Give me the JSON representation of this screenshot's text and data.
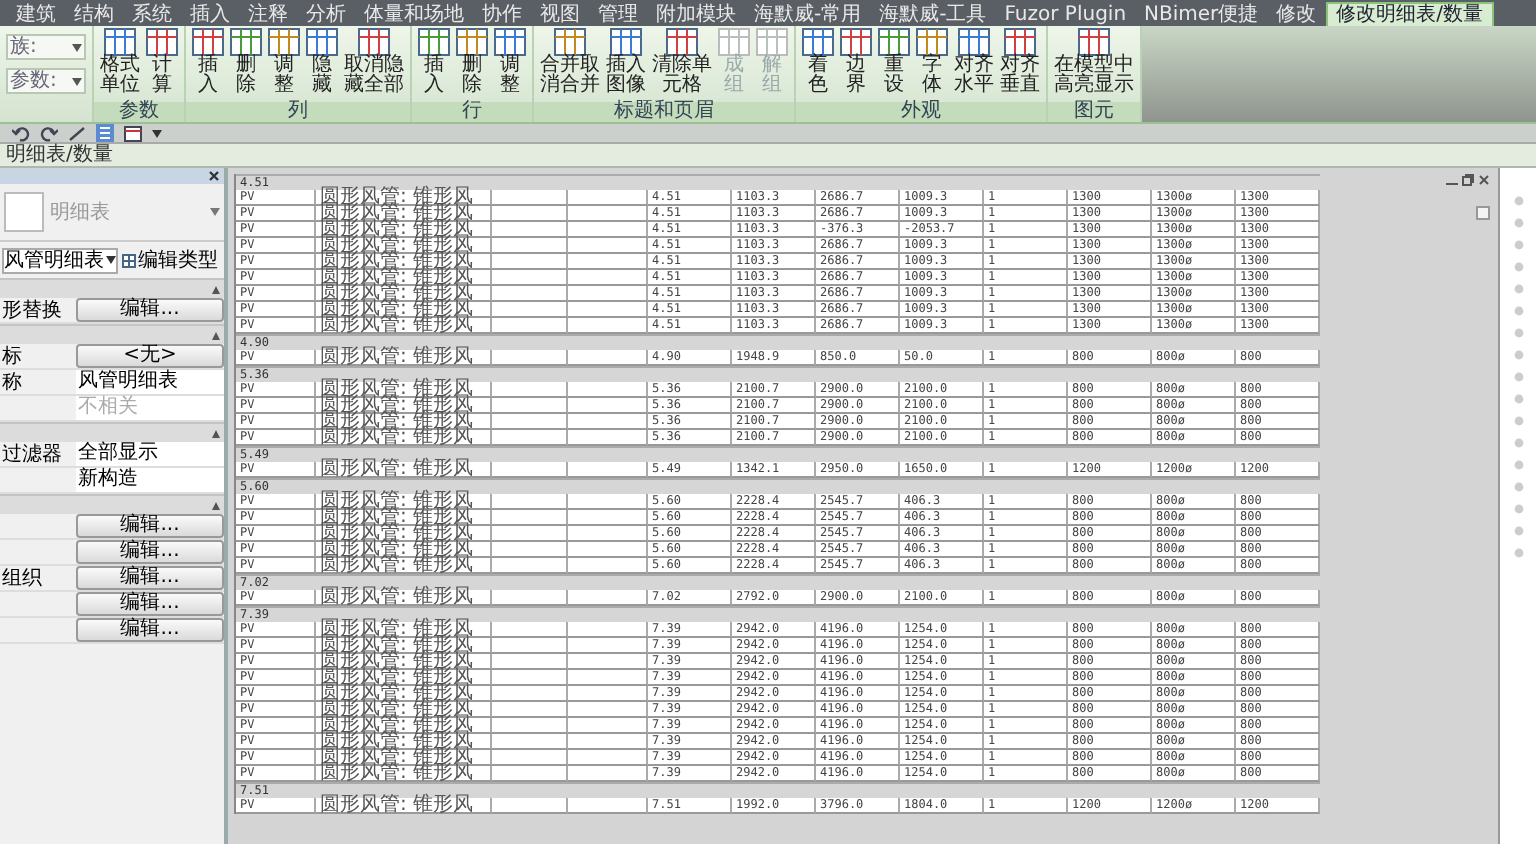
{
  "menu_tabs": [
    {
      "label": "建筑",
      "selected": false
    },
    {
      "label": "结构",
      "selected": false
    },
    {
      "label": "系统",
      "selected": false
    },
    {
      "label": "插入",
      "selected": false
    },
    {
      "label": "注释",
      "selected": false
    },
    {
      "label": "分析",
      "selected": false
    },
    {
      "label": "体量和场地",
      "selected": false
    },
    {
      "label": "协作",
      "selected": false
    },
    {
      "label": "视图",
      "selected": false
    },
    {
      "label": "管理",
      "selected": false
    },
    {
      "label": "附加模块",
      "selected": false
    },
    {
      "label": "海默威-常用",
      "selected": false
    },
    {
      "label": "海默威-工具",
      "selected": false
    },
    {
      "label": "Fuzor Plugin",
      "selected": false
    },
    {
      "label": "NBimer便捷",
      "selected": false
    },
    {
      "label": "修改",
      "selected": false
    },
    {
      "label": "修改明细表/数量",
      "selected": true
    }
  ],
  "ribbon_selectors": [
    {
      "label": "族:"
    },
    {
      "label": "参数:"
    }
  ],
  "ribbon_groups": [
    {
      "label": "参数",
      "buttons": [
        {
          "label": "格式单位",
          "disabled": false
        },
        {
          "label": "计算",
          "disabled": false
        }
      ]
    },
    {
      "label": "列",
      "buttons": [
        {
          "label": "插入",
          "disabled": false
        },
        {
          "label": "删除",
          "disabled": false
        },
        {
          "label": "调整",
          "disabled": false
        },
        {
          "label": "隐藏",
          "disabled": false
        },
        {
          "label": "取消隐藏全部",
          "disabled": false
        }
      ]
    },
    {
      "label": "行",
      "buttons": [
        {
          "label": "插入",
          "disabled": false
        },
        {
          "label": "删除",
          "disabled": false
        },
        {
          "label": "调整",
          "disabled": false
        }
      ]
    },
    {
      "label": "标题和页眉",
      "buttons": [
        {
          "label": "合并取消合并",
          "disabled": false
        },
        {
          "label": "插入图像",
          "disabled": false
        },
        {
          "label": "清除单元格",
          "disabled": false
        },
        {
          "label": "成组",
          "disabled": true
        },
        {
          "label": "解组",
          "disabled": true
        }
      ]
    },
    {
      "label": "外观",
      "buttons": [
        {
          "label": "着色",
          "disabled": false
        },
        {
          "label": "边界",
          "disabled": false
        },
        {
          "label": "重设",
          "disabled": false
        },
        {
          "label": "字体",
          "disabled": false
        },
        {
          "label": "对齐水平",
          "disabled": false
        },
        {
          "label": "对齐垂直",
          "disabled": false
        }
      ]
    },
    {
      "label": "图元",
      "buttons": [
        {
          "label": "在模型中高亮显示",
          "disabled": false
        }
      ]
    }
  ],
  "view_title": "明细表/数量",
  "properties": {
    "type_name": "明细表",
    "selector": "风管明细表",
    "edit_type": "编辑类型",
    "rows": [
      {
        "kind": "section"
      },
      {
        "kind": "button",
        "label": "形替换",
        "value": "编辑..."
      },
      {
        "kind": "section"
      },
      {
        "kind": "button",
        "label": "标",
        "value": "<无>"
      },
      {
        "kind": "text",
        "label": "称",
        "value": "风管明细表",
        "disabled": false
      },
      {
        "kind": "text",
        "value": "不相关",
        "disabled": true
      },
      {
        "kind": "section"
      },
      {
        "kind": "text",
        "label": "过滤器",
        "value": "全部显示",
        "disabled": false
      },
      {
        "kind": "text",
        "value": "新构造",
        "disabled": false
      },
      {
        "kind": "section"
      },
      {
        "kind": "button",
        "value": "编辑..."
      },
      {
        "kind": "button",
        "value": "编辑..."
      },
      {
        "kind": "button",
        "label": "组织",
        "value": "编辑..."
      },
      {
        "kind": "button",
        "value": "编辑..."
      },
      {
        "kind": "button",
        "value": "编辑..."
      }
    ]
  },
  "schedule": {
    "groups": [
      {
        "label": "4.51",
        "rows": [
          {
            "type": "PV",
            "family": "圆形风管: 锥形风",
            "values": [
              "4.51",
              "1103.3",
              "2686.7",
              "1009.3",
              "1",
              "1300",
              "1300ø",
              "1300"
            ]
          },
          {
            "type": "PV",
            "family": "圆形风管: 锥形风",
            "values": [
              "4.51",
              "1103.3",
              "2686.7",
              "1009.3",
              "1",
              "1300",
              "1300ø",
              "1300"
            ]
          },
          {
            "type": "PV",
            "family": "圆形风管: 锥形风",
            "values": [
              "4.51",
              "1103.3",
              "-376.3",
              "-2053.7",
              "1",
              "1300",
              "1300ø",
              "1300"
            ]
          },
          {
            "type": "PV",
            "family": "圆形风管: 锥形风",
            "values": [
              "4.51",
              "1103.3",
              "2686.7",
              "1009.3",
              "1",
              "1300",
              "1300ø",
              "1300"
            ]
          },
          {
            "type": "PV",
            "family": "圆形风管: 锥形风",
            "values": [
              "4.51",
              "1103.3",
              "2686.7",
              "1009.3",
              "1",
              "1300",
              "1300ø",
              "1300"
            ]
          },
          {
            "type": "PV",
            "family": "圆形风管: 锥形风",
            "values": [
              "4.51",
              "1103.3",
              "2686.7",
              "1009.3",
              "1",
              "1300",
              "1300ø",
              "1300"
            ]
          },
          {
            "type": "PV",
            "family": "圆形风管: 锥形风",
            "values": [
              "4.51",
              "1103.3",
              "2686.7",
              "1009.3",
              "1",
              "1300",
              "1300ø",
              "1300"
            ]
          },
          {
            "type": "PV",
            "family": "圆形风管: 锥形风",
            "values": [
              "4.51",
              "1103.3",
              "2686.7",
              "1009.3",
              "1",
              "1300",
              "1300ø",
              "1300"
            ]
          },
          {
            "type": "PV",
            "family": "圆形风管: 锥形风",
            "values": [
              "4.51",
              "1103.3",
              "2686.7",
              "1009.3",
              "1",
              "1300",
              "1300ø",
              "1300"
            ]
          }
        ]
      },
      {
        "label": "4.90",
        "rows": [
          {
            "type": "PV",
            "family": "圆形风管: 锥形风",
            "values": [
              "4.90",
              "1948.9",
              "850.0",
              "50.0",
              "1",
              "800",
              "800ø",
              "800"
            ]
          }
        ]
      },
      {
        "label": "5.36",
        "rows": [
          {
            "type": "PV",
            "family": "圆形风管: 锥形风",
            "values": [
              "5.36",
              "2100.7",
              "2900.0",
              "2100.0",
              "1",
              "800",
              "800ø",
              "800"
            ]
          },
          {
            "type": "PV",
            "family": "圆形风管: 锥形风",
            "values": [
              "5.36",
              "2100.7",
              "2900.0",
              "2100.0",
              "1",
              "800",
              "800ø",
              "800"
            ]
          },
          {
            "type": "PV",
            "family": "圆形风管: 锥形风",
            "values": [
              "5.36",
              "2100.7",
              "2900.0",
              "2100.0",
              "1",
              "800",
              "800ø",
              "800"
            ]
          },
          {
            "type": "PV",
            "family": "圆形风管: 锥形风",
            "values": [
              "5.36",
              "2100.7",
              "2900.0",
              "2100.0",
              "1",
              "800",
              "800ø",
              "800"
            ]
          }
        ]
      },
      {
        "label": "5.49",
        "rows": [
          {
            "type": "PV",
            "family": "圆形风管: 锥形风",
            "values": [
              "5.49",
              "1342.1",
              "2950.0",
              "1650.0",
              "1",
              "1200",
              "1200ø",
              "1200"
            ]
          }
        ]
      },
      {
        "label": "5.60",
        "rows": [
          {
            "type": "PV",
            "family": "圆形风管: 锥形风",
            "values": [
              "5.60",
              "2228.4",
              "2545.7",
              "406.3",
              "1",
              "800",
              "800ø",
              "800"
            ]
          },
          {
            "type": "PV",
            "family": "圆形风管: 锥形风",
            "values": [
              "5.60",
              "2228.4",
              "2545.7",
              "406.3",
              "1",
              "800",
              "800ø",
              "800"
            ]
          },
          {
            "type": "PV",
            "family": "圆形风管: 锥形风",
            "values": [
              "5.60",
              "2228.4",
              "2545.7",
              "406.3",
              "1",
              "800",
              "800ø",
              "800"
            ]
          },
          {
            "type": "PV",
            "family": "圆形风管: 锥形风",
            "values": [
              "5.60",
              "2228.4",
              "2545.7",
              "406.3",
              "1",
              "800",
              "800ø",
              "800"
            ]
          },
          {
            "type": "PV",
            "family": "圆形风管: 锥形风",
            "values": [
              "5.60",
              "2228.4",
              "2545.7",
              "406.3",
              "1",
              "800",
              "800ø",
              "800"
            ]
          }
        ]
      },
      {
        "label": "7.02",
        "rows": [
          {
            "type": "PV",
            "family": "圆形风管: 锥形风",
            "values": [
              "7.02",
              "2792.0",
              "2900.0",
              "2100.0",
              "1",
              "800",
              "800ø",
              "800"
            ]
          }
        ]
      },
      {
        "label": "7.39",
        "rows": [
          {
            "type": "PV",
            "family": "圆形风管: 锥形风",
            "values": [
              "7.39",
              "2942.0",
              "4196.0",
              "1254.0",
              "1",
              "800",
              "800ø",
              "800"
            ]
          },
          {
            "type": "PV",
            "family": "圆形风管: 锥形风",
            "values": [
              "7.39",
              "2942.0",
              "4196.0",
              "1254.0",
              "1",
              "800",
              "800ø",
              "800"
            ]
          },
          {
            "type": "PV",
            "family": "圆形风管: 锥形风",
            "values": [
              "7.39",
              "2942.0",
              "4196.0",
              "1254.0",
              "1",
              "800",
              "800ø",
              "800"
            ]
          },
          {
            "type": "PV",
            "family": "圆形风管: 锥形风",
            "values": [
              "7.39",
              "2942.0",
              "4196.0",
              "1254.0",
              "1",
              "800",
              "800ø",
              "800"
            ]
          },
          {
            "type": "PV",
            "family": "圆形风管: 锥形风",
            "values": [
              "7.39",
              "2942.0",
              "4196.0",
              "1254.0",
              "1",
              "800",
              "800ø",
              "800"
            ]
          },
          {
            "type": "PV",
            "family": "圆形风管: 锥形风",
            "values": [
              "7.39",
              "2942.0",
              "4196.0",
              "1254.0",
              "1",
              "800",
              "800ø",
              "800"
            ]
          },
          {
            "type": "PV",
            "family": "圆形风管: 锥形风",
            "values": [
              "7.39",
              "2942.0",
              "4196.0",
              "1254.0",
              "1",
              "800",
              "800ø",
              "800"
            ]
          },
          {
            "type": "PV",
            "family": "圆形风管: 锥形风",
            "values": [
              "7.39",
              "2942.0",
              "4196.0",
              "1254.0",
              "1",
              "800",
              "800ø",
              "800"
            ]
          },
          {
            "type": "PV",
            "family": "圆形风管: 锥形风",
            "values": [
              "7.39",
              "2942.0",
              "4196.0",
              "1254.0",
              "1",
              "800",
              "800ø",
              "800"
            ]
          },
          {
            "type": "PV",
            "family": "圆形风管: 锥形风",
            "values": [
              "7.39",
              "2942.0",
              "4196.0",
              "1254.0",
              "1",
              "800",
              "800ø",
              "800"
            ]
          }
        ]
      },
      {
        "label": "7.51",
        "rows": [
          {
            "type": "PV",
            "family": "圆形风管: 锥形风",
            "values": [
              "7.51",
              "1992.0",
              "3796.0",
              "1804.0",
              "1",
              "1200",
              "1200ø",
              "1200"
            ]
          }
        ]
      }
    ]
  }
}
